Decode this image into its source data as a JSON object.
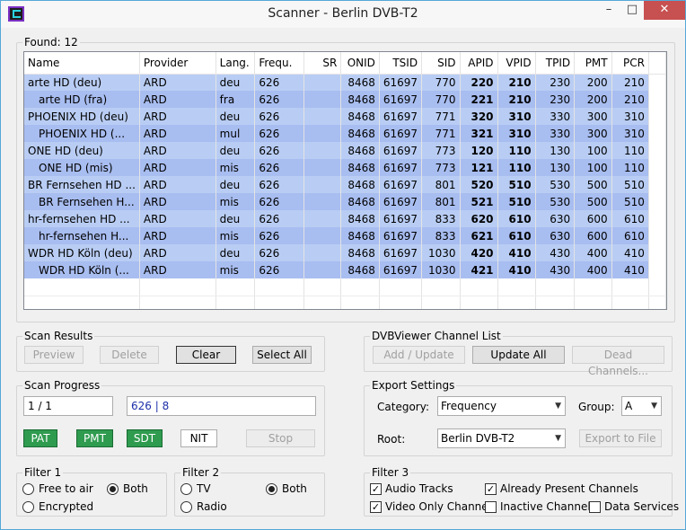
{
  "window": {
    "title": "Scanner - Berlin DVB-T2",
    "min": "–",
    "max": "□",
    "close": "✕"
  },
  "found": {
    "label": "Found:",
    "count": "12"
  },
  "table": {
    "headers": [
      "Name",
      "Provider",
      "Lang.",
      "Frequ.",
      "SR",
      "ONID",
      "TSID",
      "SID",
      "APID",
      "VPID",
      "TPID",
      "PMT",
      "PCR"
    ],
    "rows": [
      [
        "arte HD (deu)",
        "ARD",
        "deu",
        "626",
        "",
        "8468",
        "61697",
        "770",
        "220",
        "210",
        "230",
        "200",
        "210"
      ],
      [
        "arte HD (fra)",
        "ARD",
        "fra",
        "626",
        "",
        "8468",
        "61697",
        "770",
        "221",
        "210",
        "230",
        "200",
        "210"
      ],
      [
        "PHOENIX HD (deu)",
        "ARD",
        "deu",
        "626",
        "",
        "8468",
        "61697",
        "771",
        "320",
        "310",
        "330",
        "300",
        "310"
      ],
      [
        "PHOENIX HD (...",
        "ARD",
        "mul",
        "626",
        "",
        "8468",
        "61697",
        "771",
        "321",
        "310",
        "330",
        "300",
        "310"
      ],
      [
        "ONE HD (deu)",
        "ARD",
        "deu",
        "626",
        "",
        "8468",
        "61697",
        "773",
        "120",
        "110",
        "130",
        "100",
        "110"
      ],
      [
        "ONE HD (mis)",
        "ARD",
        "mis",
        "626",
        "",
        "8468",
        "61697",
        "773",
        "121",
        "110",
        "130",
        "100",
        "110"
      ],
      [
        "BR Fernsehen HD ...",
        "ARD",
        "deu",
        "626",
        "",
        "8468",
        "61697",
        "801",
        "520",
        "510",
        "530",
        "500",
        "510"
      ],
      [
        "BR Fernsehen H...",
        "ARD",
        "mis",
        "626",
        "",
        "8468",
        "61697",
        "801",
        "521",
        "510",
        "530",
        "500",
        "510"
      ],
      [
        "hr-fernsehen HD ...",
        "ARD",
        "deu",
        "626",
        "",
        "8468",
        "61697",
        "833",
        "620",
        "610",
        "630",
        "600",
        "610"
      ],
      [
        "hr-fernsehen H...",
        "ARD",
        "mis",
        "626",
        "",
        "8468",
        "61697",
        "833",
        "621",
        "610",
        "630",
        "600",
        "610"
      ],
      [
        "WDR HD Köln (deu)",
        "ARD",
        "deu",
        "626",
        "",
        "8468",
        "61697",
        "1030",
        "420",
        "410",
        "430",
        "400",
        "410"
      ],
      [
        "WDR HD Köln (...",
        "ARD",
        "mis",
        "626",
        "",
        "8468",
        "61697",
        "1030",
        "421",
        "410",
        "430",
        "400",
        "410"
      ]
    ]
  },
  "scan_results": {
    "title": "Scan Results",
    "preview": "Preview",
    "delete": "Delete",
    "clear": "Clear",
    "select_all": "Select All"
  },
  "channel_list": {
    "title": "DVBViewer Channel List",
    "add_update": "Add / Update",
    "update_all": "Update All",
    "dead": "Dead Channels..."
  },
  "scan_progress": {
    "title": "Scan Progress",
    "count": "1 / 1",
    "freq": "626 | 8",
    "pat": "PAT",
    "pmt": "PMT",
    "sdt": "SDT",
    "nit": "NIT",
    "stop": "Stop"
  },
  "export": {
    "title": "Export Settings",
    "category_label": "Category:",
    "category": "Frequency",
    "group_label": "Group:",
    "group": "A",
    "root_label": "Root:",
    "root": "Berlin DVB-T2",
    "export_btn": "Export to File"
  },
  "filter1": {
    "title": "Filter 1",
    "free": "Free to air",
    "both": "Both",
    "encrypted": "Encrypted"
  },
  "filter2": {
    "title": "Filter 2",
    "tv": "TV",
    "both": "Both",
    "radio": "Radio"
  },
  "filter3": {
    "title": "Filter 3",
    "audio": "Audio Tracks",
    "present": "Already Present Channels",
    "video": "Video Only Channel",
    "inactive": "Inactive Channels",
    "data": "Data Services",
    "check": "✓"
  }
}
